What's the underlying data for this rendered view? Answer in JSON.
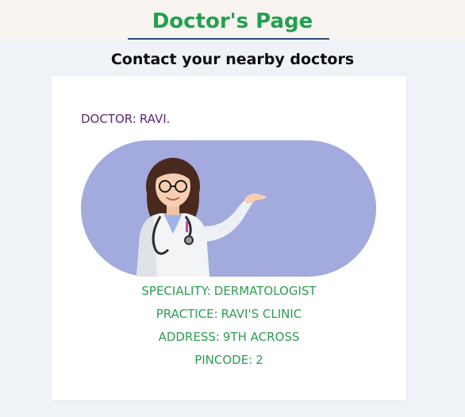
{
  "header": {
    "title": "Doctor's Page",
    "subtitle": "Contact your nearby doctors"
  },
  "doctor_card": {
    "doctor_label": "DOCTOR:",
    "doctor_name": "RAVI.",
    "image_icon": "doctor-illustration",
    "speciality_label": "SPECIALITY:",
    "speciality_value": "DERMATOLOGIST",
    "practice_label": "PRACTICE:",
    "practice_value": "RAVI'S CLINIC",
    "address_label": "ADDRESS:",
    "address_value": "9TH ACROSS",
    "pincode_label": "PINCODE:",
    "pincode_value": "2"
  },
  "colors": {
    "title_green": "#22a04f",
    "info_green": "#2e9c52",
    "name_purple": "#5a2a7a",
    "pill_background": "#a3aadd",
    "page_background": "#eff3f8",
    "header_background": "#f8f4ef"
  }
}
